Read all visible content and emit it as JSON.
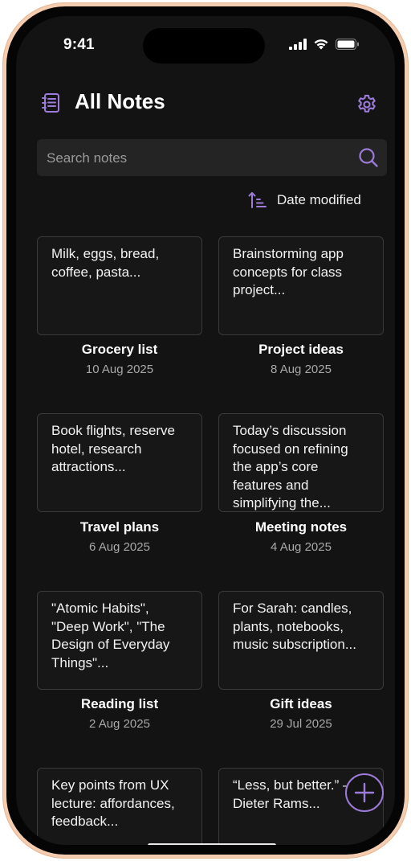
{
  "status": {
    "time": "9:41"
  },
  "header": {
    "title": "All Notes"
  },
  "search": {
    "placeholder": "Search notes"
  },
  "sort": {
    "label": "Date modified"
  },
  "notes": [
    {
      "preview": "Milk, eggs, bread, coffee, pasta...",
      "title": "Grocery list",
      "date": "10 Aug 2025"
    },
    {
      "preview": "Brainstorming app concepts for class project...",
      "title": "Project ideas",
      "date": "8 Aug 2025"
    },
    {
      "preview": "Book flights, reserve hotel, research attractions...",
      "title": "Travel plans",
      "date": "6 Aug 2025"
    },
    {
      "preview": "Today’s discussion focused on refining the app’s core features and simplifying the...",
      "title": "Meeting notes",
      "date": "4 Aug 2025"
    },
    {
      "preview": "\"Atomic Habits\", \"Deep Work\", \"The Design of Everyday Things\"...",
      "title": "Reading list",
      "date": "2 Aug 2025"
    },
    {
      "preview": "For Sarah: candles, plants, notebooks, music subscription...",
      "title": "Gift ideas",
      "date": "29 Jul 2025"
    },
    {
      "preview": "Key points from UX lecture: affordances, feedback...",
      "title": "",
      "date": ""
    },
    {
      "preview": "“Less, but better.” – Dieter Rams...",
      "title": "",
      "date": ""
    }
  ],
  "colors": {
    "accent": "#9d7bd8",
    "background": "#131313",
    "card_border": "#3a3a3a",
    "search_bg": "#242424"
  },
  "icons": {
    "notebook": "notebook-icon",
    "settings": "gear-icon",
    "search": "search-icon",
    "sort": "sort-ascending-icon",
    "add": "plus-icon"
  }
}
